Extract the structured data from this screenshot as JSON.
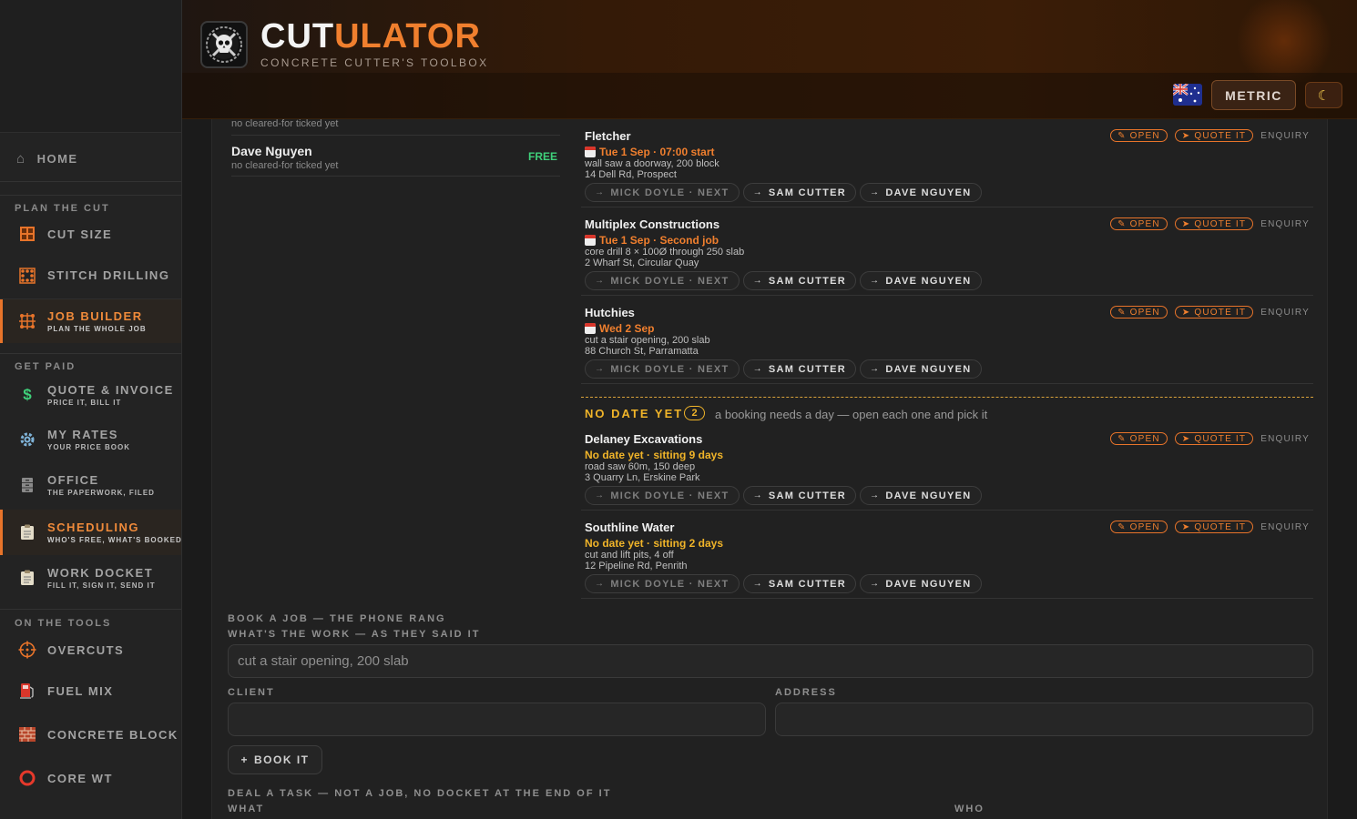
{
  "app": {
    "brand_a": "CUT",
    "brand_b": "ULATOR",
    "tagline": "CONCRETE CUTTER'S TOOLBOX",
    "units_label": "METRIC",
    "theme_icon": "moon-icon",
    "region_icon": "australia-flag-icon",
    "accent": "#f07f2e"
  },
  "sidebar": {
    "home": "HOME",
    "sections": {
      "plan": "PLAN THE CUT",
      "paid": "GET PAID",
      "tools": "ON THE TOOLS"
    },
    "items": [
      {
        "label": "CUT SIZE",
        "sub": "",
        "icon": "cut-size-icon"
      },
      {
        "label": "STITCH DRILLING",
        "sub": "",
        "icon": "stitch-drill-icon"
      },
      {
        "label": "JOB BUILDER",
        "sub": "PLAN THE WHOLE JOB",
        "icon": "job-builder-icon"
      },
      {
        "label": "QUOTE & INVOICE",
        "sub": "PRICE IT, BILL IT",
        "icon": "dollar-icon"
      },
      {
        "label": "MY RATES",
        "sub": "YOUR PRICE BOOK",
        "icon": "gear-icon"
      },
      {
        "label": "OFFICE",
        "sub": "THE PAPERWORK, FILED",
        "icon": "filing-cabinet-icon"
      },
      {
        "label": "SCHEDULING",
        "sub": "WHO'S FREE, WHAT'S BOOKED",
        "icon": "clipboard-icon"
      },
      {
        "label": "WORK DOCKET",
        "sub": "FILL IT, SIGN IT, SEND IT",
        "icon": "clipboard-icon"
      },
      {
        "label": "OVERCUTS",
        "sub": "",
        "icon": "crosshair-icon"
      },
      {
        "label": "FUEL MIX",
        "sub": "",
        "icon": "fuel-pump-icon"
      },
      {
        "label": "CONCRETE BLOCK W",
        "sub": "",
        "icon": "brick-icon"
      },
      {
        "label": "CORE WT",
        "sub": "",
        "icon": "ring-icon"
      }
    ]
  },
  "staff": {
    "partial_status": "no cleared-for ticked yet",
    "rows": [
      {
        "name": "Dave Nguyen",
        "status": "no cleared-for ticked yet",
        "badge": "FREE"
      }
    ]
  },
  "job_actions": {
    "open": "OPEN",
    "quote": "QUOTE IT",
    "status": "ENQUIRY",
    "assign": [
      "MICK DOYLE · NEXT",
      "SAM CUTTER",
      "DAVE NGUYEN"
    ]
  },
  "jobs": [
    {
      "client": "Fletcher",
      "date": "Tue 1 Sep · 07:00 start",
      "work": "wall saw a doorway, 200 block",
      "address": "14 Dell Rd, Prospect"
    },
    {
      "client": "Multiplex Constructions",
      "date": "Tue 1 Sep · Second job",
      "work": "core drill 8 × 100Ø through 250 slab",
      "address": "2 Wharf St, Circular Quay"
    },
    {
      "client": "Hutchies",
      "date": "Wed 2 Sep",
      "work": "cut a stair opening, 200 slab",
      "address": "88 Church St, Parramatta"
    }
  ],
  "no_date": {
    "title": "NO DATE YET",
    "count": "2",
    "hint": "a booking needs a day — open each one and pick it",
    "jobs": [
      {
        "client": "Delaney Excavations",
        "date": "No date yet · sitting 9 days",
        "work": "road saw 60m, 150 deep",
        "address": "3 Quarry Ln, Erskine Park"
      },
      {
        "client": "Southline Water",
        "date": "No date yet · sitting 2 days",
        "work": "cut and lift pits, 4 off",
        "address": "12 Pipeline Rd, Penrith"
      }
    ]
  },
  "booking": {
    "title": "BOOK A JOB — THE PHONE RANG",
    "work_label": "WHAT'S THE WORK — AS THEY SAID IT",
    "work_placeholder": "cut a stair opening, 200 slab",
    "client_label": "CLIENT",
    "address_label": "ADDRESS",
    "submit": "BOOK IT"
  },
  "task": {
    "title": "DEAL A TASK — NOT A JOB, NO DOCKET AT THE END OF IT",
    "what_label": "WHAT",
    "who_label": "WHO"
  }
}
